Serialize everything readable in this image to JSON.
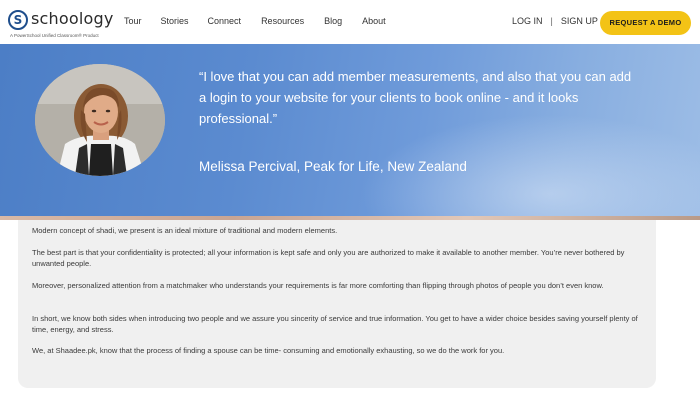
{
  "brand": {
    "logo_mark": "S",
    "name": "schoology",
    "tagline": "A PowerSchool Unified Classroom® Product",
    "color": "#1f4e8c"
  },
  "nav": {
    "links": [
      "Tour",
      "Stories",
      "Connect",
      "Resources",
      "Blog",
      "About"
    ]
  },
  "auth": {
    "login": "LOG IN",
    "separator": "|",
    "signup": "SIGN UP"
  },
  "cta": {
    "label": "REQUEST A DEMO",
    "color": "#f3c316"
  },
  "testimonial": {
    "quote": "“I love that you can add member measurements, and also that you can add a login to your website for your clients to book online - and it looks professional.”",
    "attribution": "Melissa Percival, Peak for Life, New Zealand",
    "background_color": "#5b8bd0"
  },
  "content": {
    "paragraphs": [
      "Modern concept of shadi, we present is an ideal mixture of traditional and modern elements.",
      "The best part is that your confidentiality is protected; all your information is kept safe and only you are authorized to make it available to another member. You’re never bothered by unwanted people.",
      "Moreover, personalized attention from a matchmaker who understands your requirements is far more comforting than flipping through photos of people you don’t even know.",
      "In short, we know both sides when introducing two people and we assure you sincerity of service and true information. You get to have a wider choice besides saving yourself plenty of time, energy, and stress.",
      "We, at Shaadee.pk, know that the process of finding a spouse can be time- consuming and emotionally exhausting, so we do the work for you."
    ]
  }
}
